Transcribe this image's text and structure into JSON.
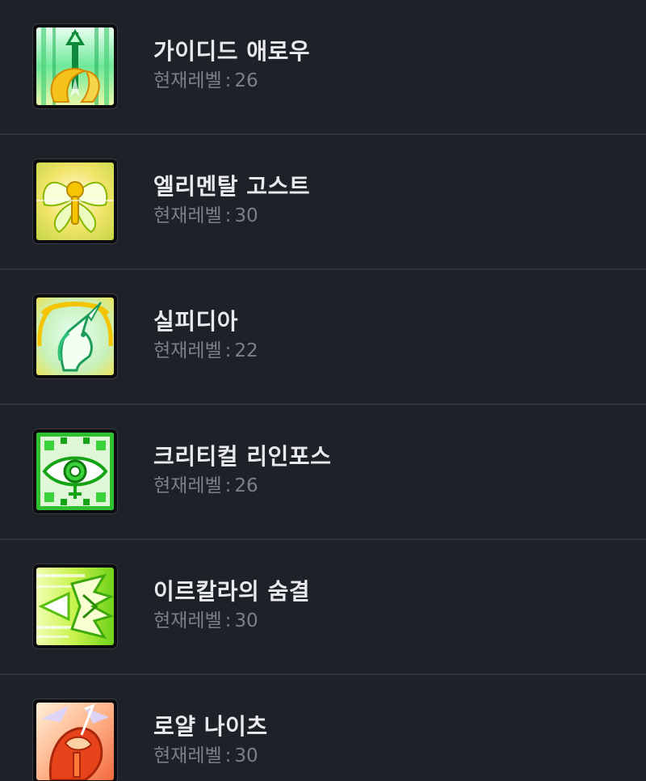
{
  "level_label": "현재레벨",
  "separator": ":",
  "skills": [
    {
      "name": "가이디드 애로우",
      "level": "26",
      "icon": "arrow-skill-icon"
    },
    {
      "name": "엘리멘탈 고스트",
      "level": "30",
      "icon": "fairy-skill-icon"
    },
    {
      "name": "실피디아",
      "level": "22",
      "icon": "unicorn-skill-icon"
    },
    {
      "name": "크리티컬 리인포스",
      "level": "26",
      "icon": "eye-skill-icon"
    },
    {
      "name": "이르칼라의 숨결",
      "level": "30",
      "icon": "breath-skill-icon"
    },
    {
      "name": "로얄 나이츠",
      "level": "30",
      "icon": "knights-skill-icon"
    }
  ]
}
